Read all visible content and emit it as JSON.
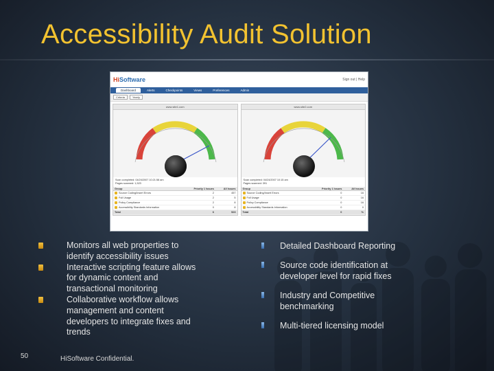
{
  "slide": {
    "title": "Accessibility Audit Solution",
    "page_number": "50",
    "footer": "HiSoftware Confidential."
  },
  "bullets_left": [
    {
      "text": "Monitors all web properties to identify accessibility issues"
    },
    {
      "text": "Interactive scripting feature allows for dynamic content and transactional monitoring"
    },
    {
      "text": "Collaborative workflow allows management and content developers to integrate fixes and trends"
    }
  ],
  "bullets_right": [
    {
      "text": "Detailed Dashboard Reporting"
    },
    {
      "text": "Source code identification at developer level for rapid fixes"
    },
    {
      "text": "Industry and Competitive benchmarking"
    },
    {
      "text": "Multi-tiered licensing model"
    }
  ],
  "dashboard": {
    "logo_prefix": "Hi",
    "logo_suffix": "Software",
    "signout": "Sign out | Help",
    "tabs": [
      "Dashboard",
      "Alerts",
      "Checkpoints",
      "Views",
      "Preferences",
      "Admin"
    ],
    "filter_label": "Criteria",
    "filter_value": "Yearly",
    "panels": [
      {
        "site": "www.site1.com",
        "scan_completed": "Scan completed: 04/24/2007 10:21:58 am",
        "pages_scanned": "Pages scanned: 1,523",
        "table_headers": [
          "Group",
          "Priority 1 Issues",
          "All Issues"
        ],
        "rows": [
          {
            "group": "Source Coding/Insert Errors",
            "p1": "2",
            "all": "457"
          },
          {
            "group": "Full Usage",
            "p1": "2",
            "all": "5"
          },
          {
            "group": "Policy Compliance",
            "p1": "2",
            "all": "8"
          },
          {
            "group": "Accessibility Standards Information",
            "p1": "0",
            "all": "8"
          }
        ],
        "total_label": "Total",
        "total_p1": "6",
        "total_all": "523"
      },
      {
        "site": "www.site2.com",
        "scan_completed": "Scan completed: 04/24/2007 10:15 am",
        "pages_scanned": "Pages scanned: 391",
        "table_headers": [
          "Group",
          "Priority 1 Issues",
          "All Issues"
        ],
        "rows": [
          {
            "group": "Source Coding/Insert Errors",
            "p1": "0",
            "all": "16"
          },
          {
            "group": "Full Usage",
            "p1": "0",
            "all": "16"
          },
          {
            "group": "Policy Compliance",
            "p1": "0",
            "all": "16"
          },
          {
            "group": "Accessibility Standards Information",
            "p1": "0",
            "all": "0"
          }
        ],
        "total_label": "Total",
        "total_p1": "0",
        "total_all": "%"
      }
    ]
  },
  "colors": {
    "title": "#f2c230",
    "accent_blue": "#2f5f9c",
    "gauge_red": "#d9433a",
    "gauge_yellow": "#e8d43a",
    "gauge_green": "#4cb84a"
  }
}
